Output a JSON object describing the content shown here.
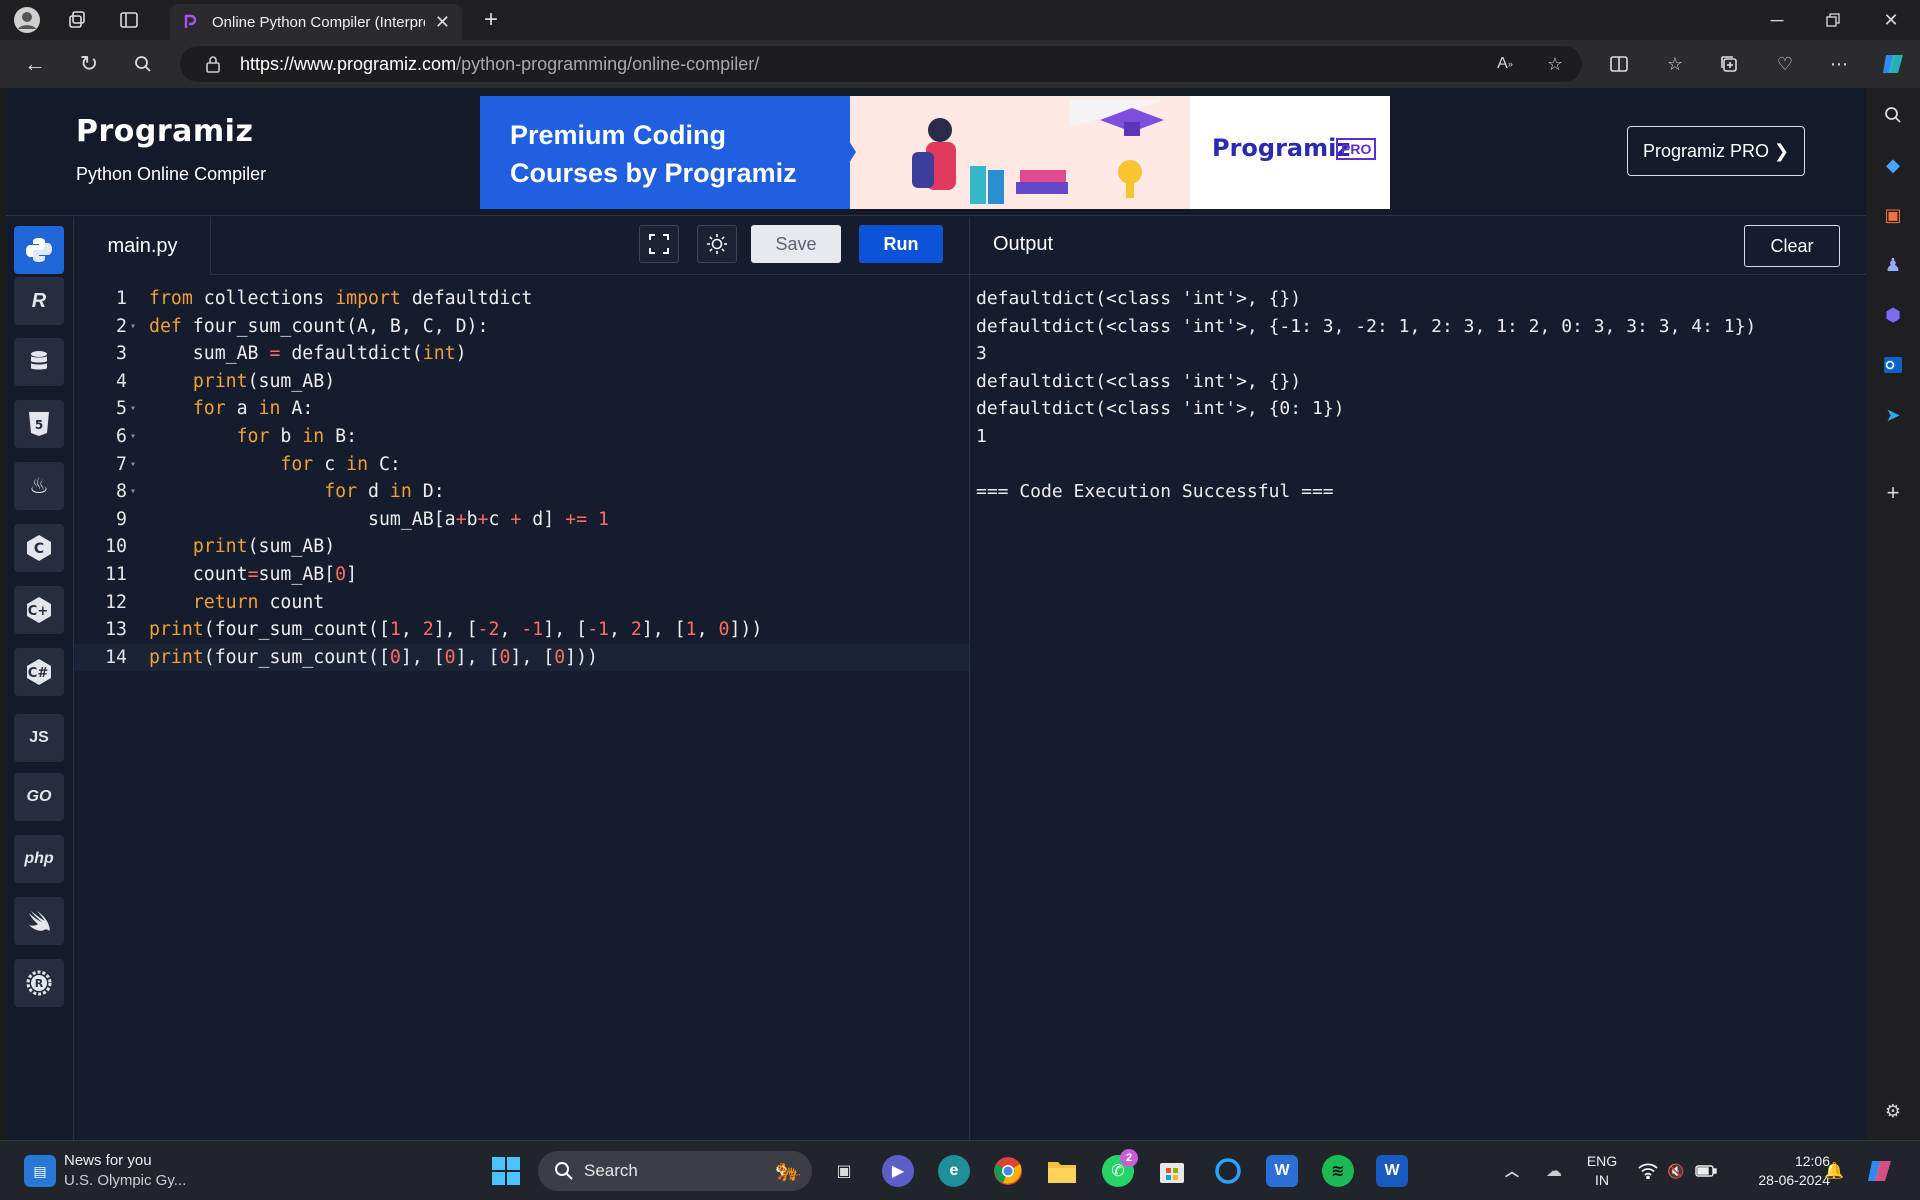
{
  "browser": {
    "tab_title": "Online Python Compiler (Interpre",
    "url_host": "https://www.programiz.com",
    "url_path": "/python-programming/online-compiler/"
  },
  "header": {
    "logo": "Programiz",
    "subtitle": "Python Online Compiler",
    "banner_text": "Premium Coding Courses by Programiz",
    "banner_brand": "Programiz",
    "banner_badge": "PRO",
    "pro_button": "Programiz PRO ❯"
  },
  "languages": [
    "python",
    "r",
    "sql",
    "html",
    "java",
    "c",
    "cpp",
    "csharp",
    "JS",
    "GO",
    "php",
    "swift",
    "rust"
  ],
  "editor": {
    "file_tab": "main.py",
    "save_label": "Save",
    "run_label": "Run",
    "lines": [
      "from collections import defaultdict",
      "def four_sum_count(A, B, C, D):",
      "    sum_AB = defaultdict(int)",
      "    print(sum_AB)",
      "    for a in A:",
      "        for b in B:",
      "            for c in C:",
      "                for d in D:",
      "                    sum_AB[a+b+c + d] += 1",
      "    print(sum_AB)",
      "    count=sum_AB[0]",
      "    return count",
      "print(four_sum_count([1, 2], [-2, -1], [-1, 2], [1, 0]))",
      "print(four_sum_count([0], [0], [0], [0]))"
    ]
  },
  "output": {
    "title": "Output",
    "clear_label": "Clear",
    "lines": [
      "defaultdict(<class 'int'>, {})",
      "defaultdict(<class 'int'>, {-1: 3, -2: 1, 2: 3, 1: 2, 0: 3, 3: 3, 4: 1})",
      "3",
      "defaultdict(<class 'int'>, {})",
      "defaultdict(<class 'int'>, {0: 1})",
      "1",
      "",
      "=== Code Execution Successful ==="
    ]
  },
  "taskbar": {
    "news_title": "News for you",
    "news_sub": "U.S. Olympic Gy...",
    "search_placeholder": "Search",
    "lang_top": "ENG",
    "lang_bottom": "IN",
    "time": "12:06",
    "date": "28-06-2024",
    "whatsapp_badge": "2"
  }
}
